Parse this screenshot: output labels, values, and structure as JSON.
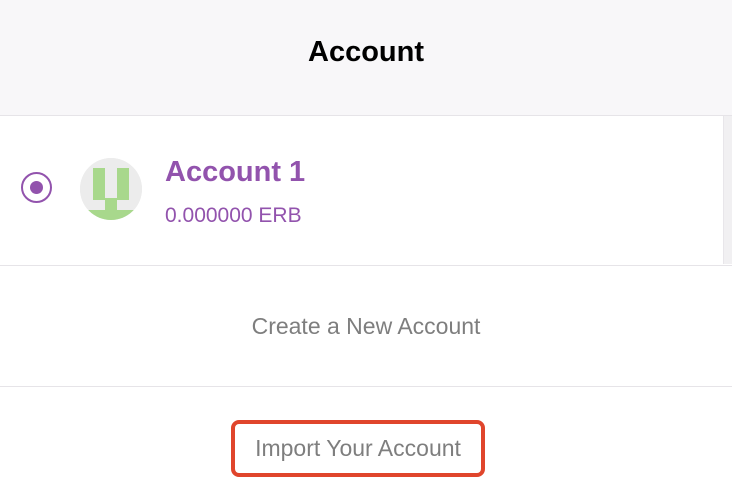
{
  "header": {
    "title": "Account"
  },
  "accounts": [
    {
      "name": "Account 1",
      "balance": "0.000000 ERB",
      "selected": true,
      "avatar_icon": "identicon-avatar",
      "avatar_colors": {
        "fg": "#a8d88c",
        "bg": "#ececec"
      }
    }
  ],
  "actions": {
    "create_label": "Create a New Account",
    "import_label": "Import Your Account"
  },
  "colors": {
    "accent": "#9253ad",
    "highlight_border": "#e0452c",
    "muted_text": "#7e7e7e"
  }
}
